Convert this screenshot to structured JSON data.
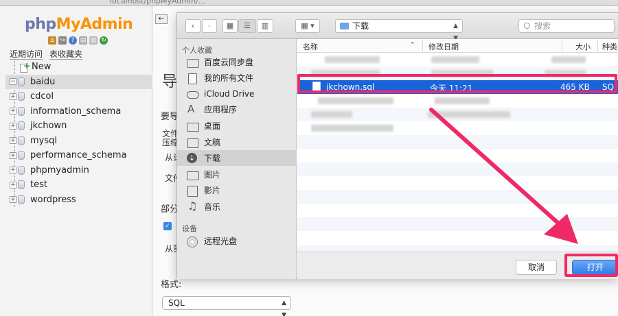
{
  "browser": {
    "url_fragment": "localhost/phpMyAdmin/..."
  },
  "pma": {
    "logo": {
      "php": "php",
      "my": "My",
      "admin": "Admin"
    },
    "nav_links": [
      "近期访问",
      "表收藏夹"
    ],
    "tree_new": "New",
    "databases": [
      "baidu",
      "cdcol",
      "information_schema",
      "jkchown",
      "mysql",
      "performance_schema",
      "phpmyadmin",
      "test",
      "wordpress"
    ],
    "selected_db": "baidu",
    "main_fragments": [
      "导",
      "要导",
      "文件",
      "压缩",
      "从计",
      "文件",
      "部分",
      "从第"
    ],
    "format_label": "格式:",
    "format_value": "SQL"
  },
  "dialog": {
    "toolbar": {
      "back": "‹",
      "forward": "›",
      "path": "下载",
      "search_placeholder": "搜索"
    },
    "sidebar": {
      "favorites_header": "个人收藏",
      "favorites": [
        {
          "label": "百度云同步盘",
          "icon": "folder-icon"
        },
        {
          "label": "我的所有文件",
          "icon": "all-files-icon"
        },
        {
          "label": "iCloud Drive",
          "icon": "cloud-icon"
        },
        {
          "label": "应用程序",
          "icon": "applications-icon"
        },
        {
          "label": "桌面",
          "icon": "desktop-icon"
        },
        {
          "label": "文稿",
          "icon": "documents-icon"
        },
        {
          "label": "下载",
          "icon": "downloads-icon"
        },
        {
          "label": "图片",
          "icon": "pictures-icon"
        },
        {
          "label": "影片",
          "icon": "movies-icon"
        },
        {
          "label": "音乐",
          "icon": "music-icon"
        }
      ],
      "devices_header": "设备",
      "devices": [
        {
          "label": "远程光盘",
          "icon": "disc-icon"
        }
      ],
      "selected": "下载"
    },
    "columns": {
      "name": "名称",
      "date": "修改日期",
      "size": "大小",
      "kind": "种类"
    },
    "selected_file": {
      "name": "jkchown.sql",
      "date": "今天 11:21",
      "size": "465 KB",
      "kind": "SQ"
    },
    "buttons": {
      "cancel": "取消",
      "open": "打开"
    }
  },
  "colors": {
    "accent_selection": "#1a63d9",
    "highlight": "#ee2a66",
    "pma_orange": "#f89406"
  }
}
